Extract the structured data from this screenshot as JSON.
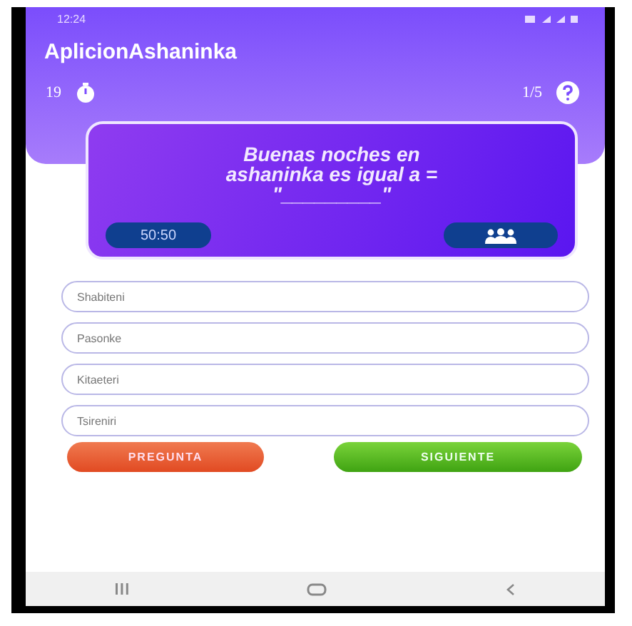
{
  "status_bar": {
    "time": "12:24"
  },
  "app_bar": {
    "title": "AplicionAshaninka"
  },
  "quiz": {
    "timer": "19",
    "progress": "1/5",
    "question": "Buenas noches en ashaninka es igual a = \"_________\"",
    "lifelines": [
      {
        "kind": "fifty",
        "label": "50:50"
      },
      {
        "kind": "audience"
      }
    ],
    "answers": [
      {
        "text": "Shabiteni"
      },
      {
        "text": "Pasonke"
      },
      {
        "text": "Kitaeteri"
      },
      {
        "text": "Tsireniri"
      }
    ],
    "buttons": [
      {
        "kind": "question",
        "label": "PREGUNTA"
      },
      {
        "kind": "next",
        "label": "SIGUIENTE"
      }
    ]
  },
  "nav_bar": [
    {
      "kind": "recents"
    },
    {
      "kind": "home"
    },
    {
      "kind": "back"
    }
  ]
}
